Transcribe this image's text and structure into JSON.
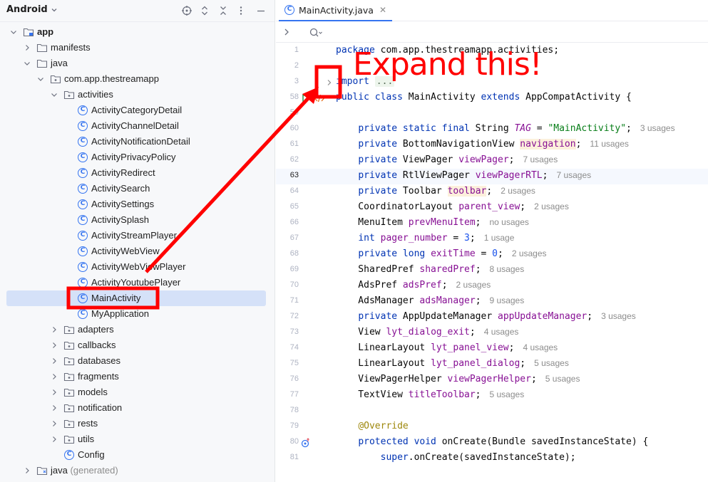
{
  "project_panel": {
    "view_label": "Android",
    "tree": [
      {
        "label": "app",
        "depth": 0,
        "type": "module",
        "expanded": true,
        "bold": true
      },
      {
        "label": "manifests",
        "depth": 1,
        "type": "folder",
        "expanded": false
      },
      {
        "label": "java",
        "depth": 1,
        "type": "folder",
        "expanded": true
      },
      {
        "label": "com.app.thestreamapp",
        "depth": 2,
        "type": "package",
        "expanded": true
      },
      {
        "label": "activities",
        "depth": 3,
        "type": "package",
        "expanded": true
      },
      {
        "label": "ActivityCategoryDetail",
        "depth": 4,
        "type": "class"
      },
      {
        "label": "ActivityChannelDetail",
        "depth": 4,
        "type": "class"
      },
      {
        "label": "ActivityNotificationDetail",
        "depth": 4,
        "type": "class"
      },
      {
        "label": "ActivityPrivacyPolicy",
        "depth": 4,
        "type": "class"
      },
      {
        "label": "ActivityRedirect",
        "depth": 4,
        "type": "class"
      },
      {
        "label": "ActivitySearch",
        "depth": 4,
        "type": "class"
      },
      {
        "label": "ActivitySettings",
        "depth": 4,
        "type": "class"
      },
      {
        "label": "ActivitySplash",
        "depth": 4,
        "type": "class"
      },
      {
        "label": "ActivityStreamPlayer",
        "depth": 4,
        "type": "class"
      },
      {
        "label": "ActivityWebView",
        "depth": 4,
        "type": "class"
      },
      {
        "label": "ActivityWebViewPlayer",
        "depth": 4,
        "type": "class"
      },
      {
        "label": "ActivityYoutubePlayer",
        "depth": 4,
        "type": "class"
      },
      {
        "label": "MainActivity",
        "depth": 4,
        "type": "class",
        "selected": true
      },
      {
        "label": "MyApplication",
        "depth": 4,
        "type": "class"
      },
      {
        "label": "adapters",
        "depth": 3,
        "type": "package",
        "expanded": false
      },
      {
        "label": "callbacks",
        "depth": 3,
        "type": "package",
        "expanded": false
      },
      {
        "label": "databases",
        "depth": 3,
        "type": "package",
        "expanded": false
      },
      {
        "label": "fragments",
        "depth": 3,
        "type": "package",
        "expanded": false
      },
      {
        "label": "models",
        "depth": 3,
        "type": "package",
        "expanded": false
      },
      {
        "label": "notification",
        "depth": 3,
        "type": "package",
        "expanded": false
      },
      {
        "label": "rests",
        "depth": 3,
        "type": "package",
        "expanded": false
      },
      {
        "label": "utils",
        "depth": 3,
        "type": "package",
        "expanded": false
      },
      {
        "label": "Config",
        "depth": 3,
        "type": "class"
      },
      {
        "label": "java",
        "suffix": " (generated)",
        "depth": 1,
        "type": "folder-generated",
        "expanded": false
      }
    ]
  },
  "editor": {
    "tab_label": "MainActivity.java",
    "current_line": "63",
    "lines": [
      {
        "n": "1",
        "tokens": [
          {
            "t": "package",
            "c": "kw"
          },
          {
            "t": " com.app.thestreamapp.activities;"
          }
        ]
      },
      {
        "n": "2",
        "tokens": []
      },
      {
        "n": "3",
        "fold": true,
        "tokens": [
          {
            "t": "import",
            "c": "kw"
          },
          {
            "t": " "
          },
          {
            "t": "...",
            "c": "fold-box"
          }
        ]
      },
      {
        "n": "58",
        "run": true,
        "tokens": [
          {
            "t": "public class",
            "c": "kw"
          },
          {
            "t": " MainActivity "
          },
          {
            "t": "extends",
            "c": "kw"
          },
          {
            "t": " AppCompatActivity {"
          }
        ]
      },
      {
        "n": "59",
        "tokens": []
      },
      {
        "n": "60",
        "tokens": [
          {
            "t": "    "
          },
          {
            "t": "private static final",
            "c": "kw"
          },
          {
            "t": " String "
          },
          {
            "t": "TAG",
            "c": "tagfld"
          },
          {
            "t": " = "
          },
          {
            "t": "\"MainActivity\"",
            "c": "str"
          },
          {
            "t": ";"
          }
        ],
        "usage": "3 usages"
      },
      {
        "n": "61",
        "tokens": [
          {
            "t": "    "
          },
          {
            "t": "private",
            "c": "kw"
          },
          {
            "t": " BottomNavigationView "
          },
          {
            "t": "navigation",
            "c": "fld-hl"
          },
          {
            "t": ";"
          }
        ],
        "usage": "11 usages"
      },
      {
        "n": "62",
        "tokens": [
          {
            "t": "    "
          },
          {
            "t": "private",
            "c": "kw"
          },
          {
            "t": " ViewPager "
          },
          {
            "t": "viewPager",
            "c": "fld"
          },
          {
            "t": ";"
          }
        ],
        "usage": "7 usages"
      },
      {
        "n": "63",
        "tokens": [
          {
            "t": "    "
          },
          {
            "t": "private",
            "c": "kw"
          },
          {
            "t": " RtlViewPager "
          },
          {
            "t": "viewPagerRTL",
            "c": "fld"
          },
          {
            "t": ";"
          }
        ],
        "usage": "7 usages"
      },
      {
        "n": "64",
        "tokens": [
          {
            "t": "    "
          },
          {
            "t": "private",
            "c": "kw"
          },
          {
            "t": " Toolbar "
          },
          {
            "t": "toolbar",
            "c": "fld-hl"
          },
          {
            "t": ";"
          }
        ],
        "usage": "2 usages"
      },
      {
        "n": "65",
        "tokens": [
          {
            "t": "    CoordinatorLayout "
          },
          {
            "t": "parent_view",
            "c": "fld"
          },
          {
            "t": ";"
          }
        ],
        "usage": "2 usages"
      },
      {
        "n": "66",
        "tokens": [
          {
            "t": "    MenuItem "
          },
          {
            "t": "prevMenuItem",
            "c": "fld"
          },
          {
            "t": ";"
          }
        ],
        "usage": "no usages"
      },
      {
        "n": "67",
        "tokens": [
          {
            "t": "    "
          },
          {
            "t": "int",
            "c": "kw"
          },
          {
            "t": " "
          },
          {
            "t": "pager_number",
            "c": "fld"
          },
          {
            "t": " = "
          },
          {
            "t": "3",
            "c": "num"
          },
          {
            "t": ";"
          }
        ],
        "usage": "1 usage"
      },
      {
        "n": "68",
        "tokens": [
          {
            "t": "    "
          },
          {
            "t": "private long",
            "c": "kw"
          },
          {
            "t": " "
          },
          {
            "t": "exitTime",
            "c": "fld"
          },
          {
            "t": " = "
          },
          {
            "t": "0",
            "c": "num"
          },
          {
            "t": ";"
          }
        ],
        "usage": "2 usages"
      },
      {
        "n": "69",
        "tokens": [
          {
            "t": "    SharedPref "
          },
          {
            "t": "sharedPref",
            "c": "fld"
          },
          {
            "t": ";"
          }
        ],
        "usage": "8 usages"
      },
      {
        "n": "70",
        "tokens": [
          {
            "t": "    AdsPref "
          },
          {
            "t": "adsPref",
            "c": "fld"
          },
          {
            "t": ";"
          }
        ],
        "usage": "2 usages"
      },
      {
        "n": "71",
        "tokens": [
          {
            "t": "    AdsManager "
          },
          {
            "t": "adsManager",
            "c": "fld"
          },
          {
            "t": ";"
          }
        ],
        "usage": "9 usages"
      },
      {
        "n": "72",
        "tokens": [
          {
            "t": "    "
          },
          {
            "t": "private",
            "c": "kw"
          },
          {
            "t": " AppUpdateManager "
          },
          {
            "t": "appUpdateManager",
            "c": "fld"
          },
          {
            "t": ";"
          }
        ],
        "usage": "3 usages"
      },
      {
        "n": "73",
        "tokens": [
          {
            "t": "    View "
          },
          {
            "t": "lyt_dialog_exit",
            "c": "fld"
          },
          {
            "t": ";"
          }
        ],
        "usage": "4 usages"
      },
      {
        "n": "74",
        "tokens": [
          {
            "t": "    LinearLayout "
          },
          {
            "t": "lyt_panel_view",
            "c": "fld"
          },
          {
            "t": ";"
          }
        ],
        "usage": "4 usages"
      },
      {
        "n": "75",
        "tokens": [
          {
            "t": "    LinearLayout "
          },
          {
            "t": "lyt_panel_dialog",
            "c": "fld"
          },
          {
            "t": ";"
          }
        ],
        "usage": "5 usages"
      },
      {
        "n": "76",
        "tokens": [
          {
            "t": "    ViewPagerHelper "
          },
          {
            "t": "viewPagerHelper",
            "c": "fld"
          },
          {
            "t": ";"
          }
        ],
        "usage": "5 usages"
      },
      {
        "n": "77",
        "tokens": [
          {
            "t": "    TextView "
          },
          {
            "t": "titleToolbar",
            "c": "fld"
          },
          {
            "t": ";"
          }
        ],
        "usage": "5 usages"
      },
      {
        "n": "78",
        "tokens": []
      },
      {
        "n": "79",
        "tokens": [
          {
            "t": "    "
          },
          {
            "t": "@Override",
            "c": "ann"
          }
        ]
      },
      {
        "n": "80",
        "override": true,
        "tokens": [
          {
            "t": "    "
          },
          {
            "t": "protected void",
            "c": "kw"
          },
          {
            "t": " onCreate(Bundle savedInstanceState) {"
          }
        ]
      },
      {
        "n": "81",
        "tokens": [
          {
            "t": "        "
          },
          {
            "t": "super",
            "c": "kw"
          },
          {
            "t": ".onCreate(savedInstanceState);"
          }
        ]
      }
    ]
  },
  "annotation": {
    "text": "Expand this!",
    "color": "#ff0000"
  },
  "colors": {
    "selection": "#d5e1f8",
    "accent": "#3574f0",
    "keyword": "#0033b3",
    "field": "#871094",
    "string": "#067d17"
  }
}
